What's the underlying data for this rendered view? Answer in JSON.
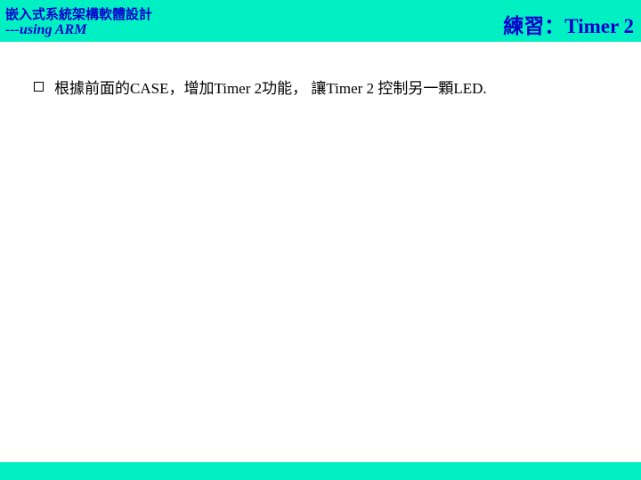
{
  "header": {
    "course_title": "嵌入式系統架構軟體設計",
    "course_subtitle": "---using ARM",
    "slide_title": "練習：Timer 2",
    "band_color": "#00f0c3",
    "text_color": "#0000cc"
  },
  "body": {
    "bullets": [
      {
        "icon": "hollow-square-bullet-icon",
        "text": "根據前面的CASE，增加Timer 2功能， 讓Timer 2 控制另一顆LED."
      }
    ]
  }
}
